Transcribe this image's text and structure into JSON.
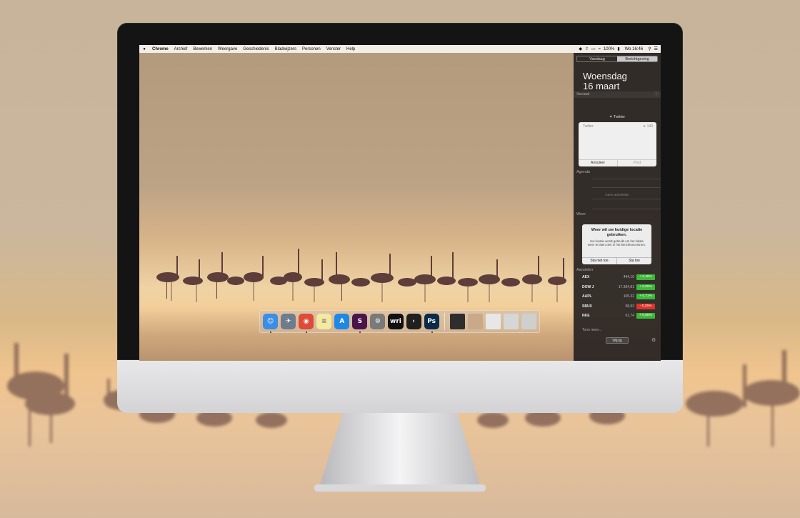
{
  "menubar": {
    "app_name": "Chrome",
    "menus": [
      "Archief",
      "Bewerken",
      "Weergave",
      "Geschiedenis",
      "Bladwijzers",
      "Personen",
      "Venster",
      "Help"
    ],
    "battery": "100%",
    "clock": "Wo 16:46"
  },
  "notification_center": {
    "tabs": [
      "Vandaag",
      "Berichtgeving"
    ],
    "date_line1": "Woensdag",
    "date_line2": "16 maart",
    "social": {
      "section": "Sociaal",
      "service": "Twitter",
      "field_label": "Twitter",
      "char_count": "140",
      "cancel": "Annuleer",
      "post": "Post"
    },
    "agenda": {
      "section": "Agenda",
      "empty": "Geen activiteiten"
    },
    "weather": {
      "section": "Weer",
      "title": "Weer wil uw huidige locatie gebruiken.",
      "desc": "Uw locatie wordt gebruikt om het lokale weer te laten zien in het berichtencentrum.",
      "deny": "Sta niet toe",
      "allow": "Sta toe"
    },
    "stocks": {
      "section": "Aandelen",
      "items": [
        {
          "name": "AEX",
          "price": "444,10",
          "change": "+ 0,48%",
          "color": "#3db839"
        },
        {
          "name": "DOW J",
          "price": "17.364,81",
          "change": "+ 0,08%",
          "color": "#3db839"
        },
        {
          "name": "AAPL",
          "price": "105,32",
          "change": "+ 0,71%",
          "color": "#3db839"
        },
        {
          "name": "SBUX",
          "price": "58,93",
          "change": "- 0,25%",
          "color": "#e0332c"
        },
        {
          "name": "NKE",
          "price": "61,74",
          "change": "+ 0,55%",
          "color": "#3db839"
        }
      ],
      "more": "Toon meer..."
    },
    "edit_button": "Wijzig"
  },
  "dock": {
    "apps": [
      {
        "icon": "finder-icon",
        "glyph": "☺",
        "bg": "#3a8ee6",
        "running": true
      },
      {
        "icon": "launchpad-icon",
        "glyph": "✈",
        "bg": "#6f7c8c",
        "running": false
      },
      {
        "icon": "chrome-icon",
        "glyph": "◉",
        "bg": "#dd4b39",
        "running": true
      },
      {
        "icon": "notes-icon",
        "glyph": "≡",
        "bg": "#f5e8a0",
        "running": false
      },
      {
        "icon": "appstore-icon",
        "glyph": "A",
        "bg": "#1e88e5",
        "running": false
      },
      {
        "icon": "slack-icon",
        "glyph": "S",
        "bg": "#4a154b",
        "running": true
      },
      {
        "icon": "system-preferences-icon",
        "glyph": "⚙",
        "bg": "#7a7a7a",
        "running": false
      },
      {
        "icon": "writer-icon",
        "glyph": "wri",
        "bg": "#111111",
        "running": false
      },
      {
        "icon": "plex-icon",
        "glyph": "›",
        "bg": "#1f1f1f",
        "running": false
      },
      {
        "icon": "photoshop-icon",
        "glyph": "Ps",
        "bg": "#0b2a4a",
        "running": true
      }
    ],
    "docs": [
      {
        "icon": "document-stack-icon",
        "bg": "#2e2e2e"
      },
      {
        "icon": "folder-stack-icon",
        "bg": "#c9a98a"
      },
      {
        "icon": "screenshot-stack-icon",
        "bg": "#e7e7e7"
      },
      {
        "icon": "downloads-stack-icon",
        "bg": "#d6d6d6"
      },
      {
        "icon": "trash-icon",
        "bg": "#cfcfcf"
      }
    ]
  }
}
